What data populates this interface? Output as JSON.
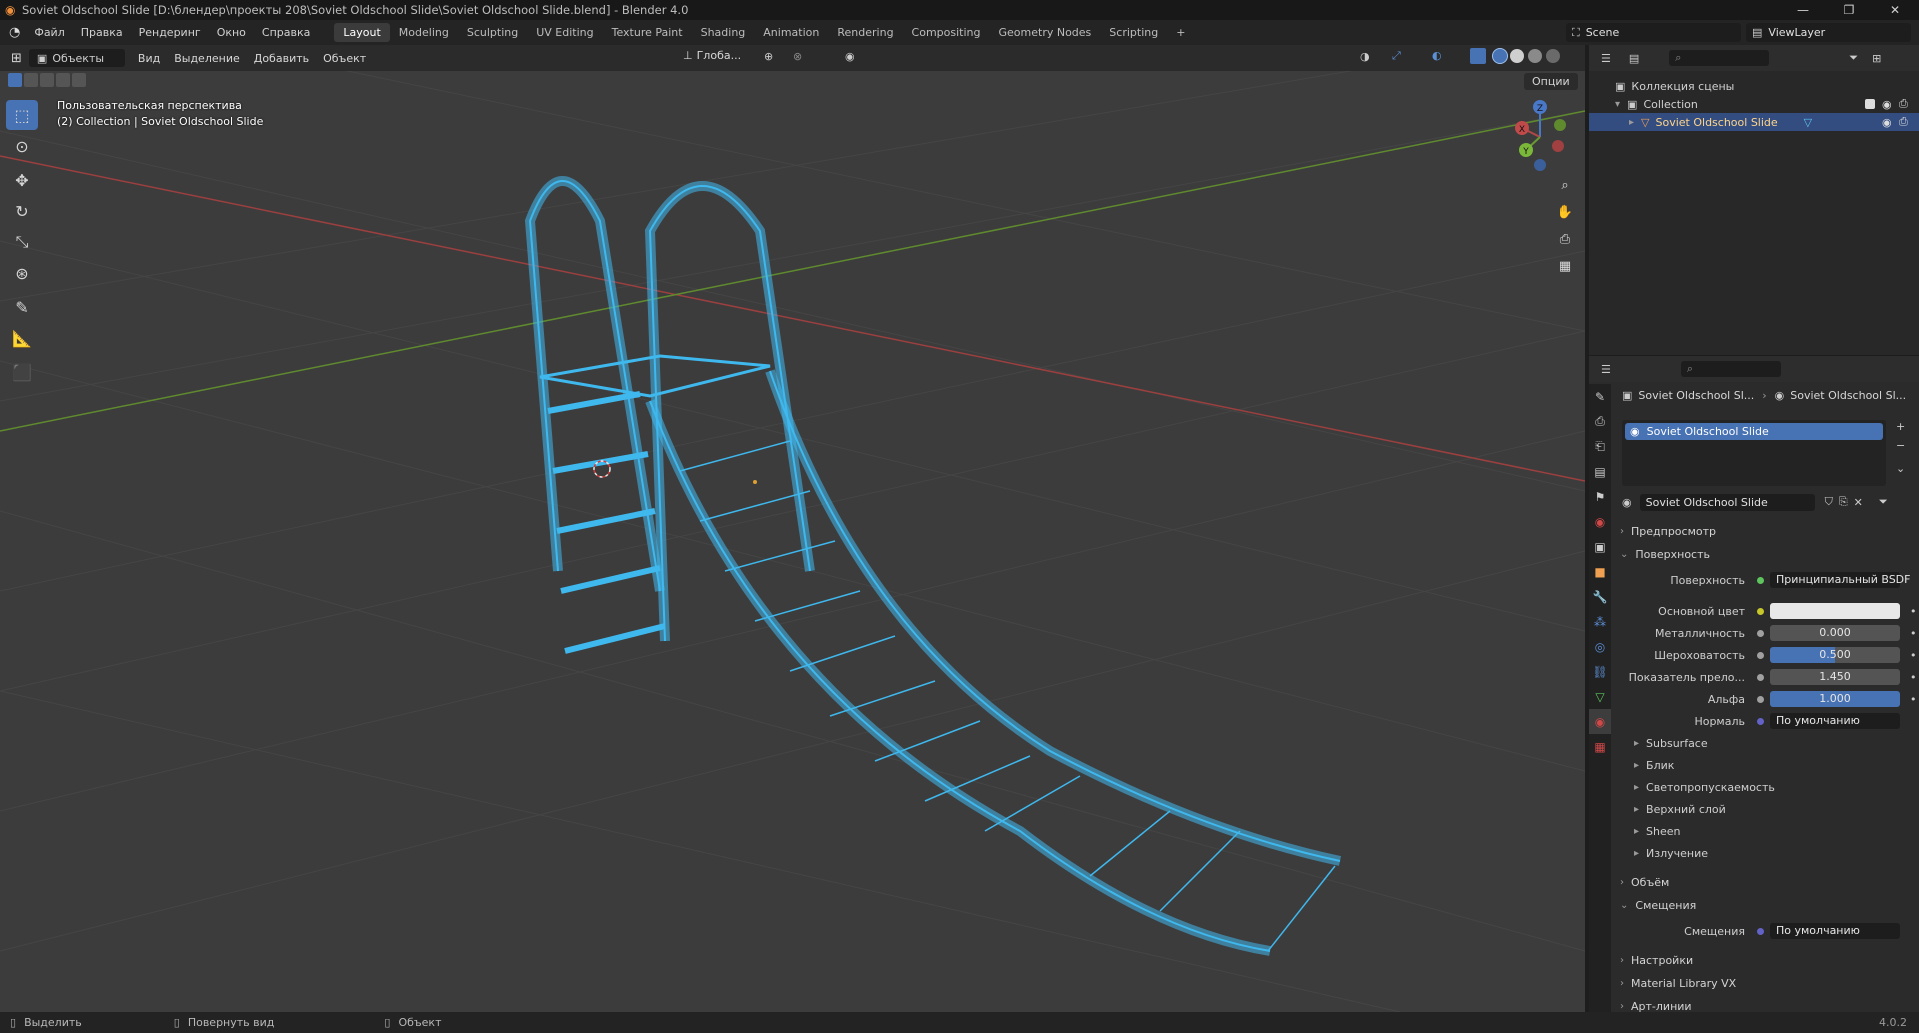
{
  "window": {
    "title": "Soviet Oldschool Slide [D:\\блендер\\проекты 208\\Soviet Oldschool Slide\\Soviet Oldschool Slide.blend] - Blender 4.0",
    "min": "—",
    "max": "❐",
    "close": "✕"
  },
  "menu": [
    "Файл",
    "Правка",
    "Рендеринг",
    "Окно",
    "Справка"
  ],
  "workspaces": [
    "Layout",
    "Modeling",
    "Sculpting",
    "UV Editing",
    "Texture Paint",
    "Shading",
    "Animation",
    "Rendering",
    "Compositing",
    "Geometry Nodes",
    "Scripting"
  ],
  "workspace_add": "+",
  "scene": "Scene",
  "view_layer": "ViewLayer",
  "viewport_header": {
    "mode": "Объекты",
    "menus": [
      "Вид",
      "Выделение",
      "Добавить",
      "Объект"
    ],
    "transform": "Глоба...",
    "options": "Опции"
  },
  "viewport": {
    "perspective": "Пользовательская перспектива",
    "collection_info": "(2) Collection | Soviet Oldschool Slide",
    "gizmo_x": "X",
    "gizmo_y": "Y",
    "gizmo_z": "Z"
  },
  "outliner": {
    "scene_collection": "Коллекция сцены",
    "collection": "Collection",
    "object": "Soviet Oldschool Slide"
  },
  "properties": {
    "breadcrumb_obj": "Soviet Oldschool Sl...",
    "breadcrumb_mat": "Soviet Oldschool Sl...",
    "material_slot": "Soviet Oldschool Slide",
    "material_name": "Soviet Oldschool Slide",
    "preview": "Предпросмотр",
    "surface_section": "Поверхность",
    "surface_label": "Поверхность",
    "surface_value": "Принципиальный BSDF",
    "base_color_label": "Основной цвет",
    "metallic_label": "Металличность",
    "metallic": "0.000",
    "roughness_label": "Шероховатость",
    "roughness": "0.500",
    "ior_label": "Показатель прело...",
    "ior": "1.450",
    "alpha_label": "Альфа",
    "alpha": "1.000",
    "normal_label": "Нормаль",
    "normal_value": "По умолчанию",
    "subpanels": [
      "Subsurface",
      "Блик",
      "Светопропускаемость",
      "Верхний слой",
      "Sheen",
      "Излучение"
    ],
    "volume": "Объём",
    "displacement_section": "Смещения",
    "displacement_label": "Смещения",
    "displacement_value": "По умолчанию",
    "settings": "Настройки",
    "material_library": "Material Library VX",
    "line_art": "Арт-линии"
  },
  "status": {
    "select": "Выделить",
    "rotate": "Повернуть вид",
    "object": "Объект",
    "version": "4.0.2"
  },
  "colors": {
    "accent": "#4772b3",
    "wire": "#3fb8ee",
    "x_axis": "#b04848",
    "y_axis": "#6a9a32"
  }
}
